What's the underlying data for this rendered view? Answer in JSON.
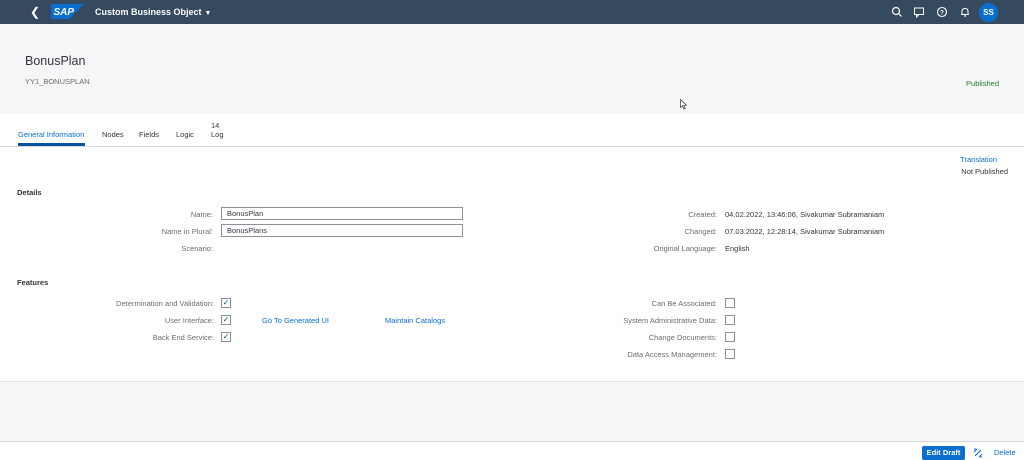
{
  "shell": {
    "app_title": "Custom Business Object",
    "logo_text": "SAP",
    "avatar_initials": "SS",
    "icons": [
      "back-icon",
      "search-icon",
      "feedback-icon",
      "help-icon",
      "notification-bell-icon"
    ]
  },
  "object": {
    "title": "BonusPlan",
    "id": "YY1_BONUSPLAN",
    "status": "Published"
  },
  "tabs": [
    {
      "label": "General Information",
      "active": true
    },
    {
      "label": "Nodes"
    },
    {
      "label": "Fields"
    },
    {
      "label": "Logic"
    },
    {
      "label": "Log",
      "count": "14"
    }
  ],
  "translation": {
    "link": "Translation",
    "status": "Not Published"
  },
  "details": {
    "heading": "Details",
    "name_label": "Name:",
    "name_value": "BonusPlan",
    "plural_label": "Name in Plural:",
    "plural_value": "BonusPlans",
    "scenario_label": "Scenario:",
    "created_label": "Created:",
    "created_value": "04.02.2022, 13:46:06, Sivakumar Subramaniam",
    "changed_label": "Changed:",
    "changed_value": "07.03.2022, 12:28:14, Sivakumar Subramaniam",
    "language_label": "Original Language:",
    "language_value": "English"
  },
  "features": {
    "heading": "Features",
    "left": [
      {
        "label": "Determination and Validation:",
        "checked": true
      },
      {
        "label": "User Interface:",
        "checked": true
      },
      {
        "label": "Back End Service:",
        "checked": true
      }
    ],
    "right": [
      {
        "label": "Can Be Associated:",
        "checked": false
      },
      {
        "label": "System Administrative Data:",
        "checked": false
      },
      {
        "label": "Change Documents:",
        "checked": false
      },
      {
        "label": "Data Access Management:",
        "checked": false
      }
    ],
    "links": {
      "generated_ui": "Go To Generated UI",
      "catalogs": "Maintain Catalogs"
    }
  },
  "footer": {
    "edit_draft": "Edit Draft",
    "delete": "Delete"
  },
  "colors": {
    "shell": "#354a5f",
    "accent": "#0a6ed1",
    "status_positive": "#2b7d2b"
  }
}
